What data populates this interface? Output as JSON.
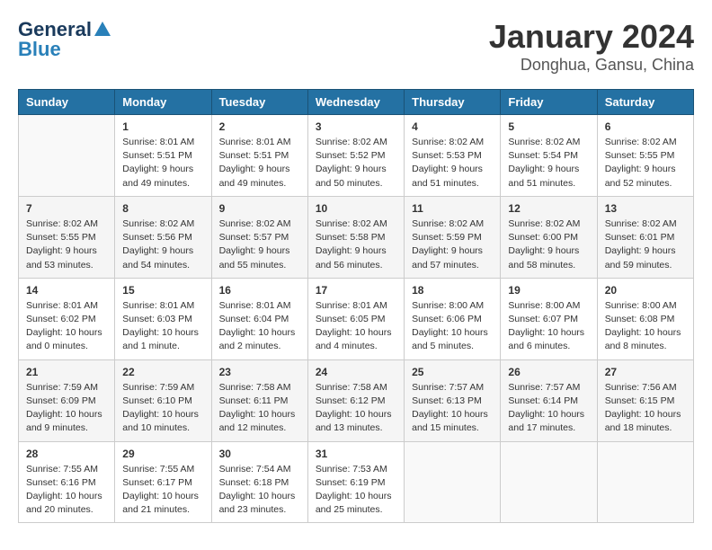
{
  "header": {
    "logo_general": "General",
    "logo_blue": "Blue",
    "month": "January 2024",
    "location": "Donghua, Gansu, China"
  },
  "days_of_week": [
    "Sunday",
    "Monday",
    "Tuesday",
    "Wednesday",
    "Thursday",
    "Friday",
    "Saturday"
  ],
  "weeks": [
    [
      {
        "day": "",
        "info": ""
      },
      {
        "day": "1",
        "info": "Sunrise: 8:01 AM\nSunset: 5:51 PM\nDaylight: 9 hours and 49 minutes."
      },
      {
        "day": "2",
        "info": "Sunrise: 8:01 AM\nSunset: 5:51 PM\nDaylight: 9 hours and 49 minutes."
      },
      {
        "day": "3",
        "info": "Sunrise: 8:02 AM\nSunset: 5:52 PM\nDaylight: 9 hours and 50 minutes."
      },
      {
        "day": "4",
        "info": "Sunrise: 8:02 AM\nSunset: 5:53 PM\nDaylight: 9 hours and 51 minutes."
      },
      {
        "day": "5",
        "info": "Sunrise: 8:02 AM\nSunset: 5:54 PM\nDaylight: 9 hours and 51 minutes."
      },
      {
        "day": "6",
        "info": "Sunrise: 8:02 AM\nSunset: 5:55 PM\nDaylight: 9 hours and 52 minutes."
      }
    ],
    [
      {
        "day": "7",
        "info": "Sunrise: 8:02 AM\nSunset: 5:55 PM\nDaylight: 9 hours and 53 minutes."
      },
      {
        "day": "8",
        "info": "Sunrise: 8:02 AM\nSunset: 5:56 PM\nDaylight: 9 hours and 54 minutes."
      },
      {
        "day": "9",
        "info": "Sunrise: 8:02 AM\nSunset: 5:57 PM\nDaylight: 9 hours and 55 minutes."
      },
      {
        "day": "10",
        "info": "Sunrise: 8:02 AM\nSunset: 5:58 PM\nDaylight: 9 hours and 56 minutes."
      },
      {
        "day": "11",
        "info": "Sunrise: 8:02 AM\nSunset: 5:59 PM\nDaylight: 9 hours and 57 minutes."
      },
      {
        "day": "12",
        "info": "Sunrise: 8:02 AM\nSunset: 6:00 PM\nDaylight: 9 hours and 58 minutes."
      },
      {
        "day": "13",
        "info": "Sunrise: 8:02 AM\nSunset: 6:01 PM\nDaylight: 9 hours and 59 minutes."
      }
    ],
    [
      {
        "day": "14",
        "info": "Sunrise: 8:01 AM\nSunset: 6:02 PM\nDaylight: 10 hours and 0 minutes."
      },
      {
        "day": "15",
        "info": "Sunrise: 8:01 AM\nSunset: 6:03 PM\nDaylight: 10 hours and 1 minute."
      },
      {
        "day": "16",
        "info": "Sunrise: 8:01 AM\nSunset: 6:04 PM\nDaylight: 10 hours and 2 minutes."
      },
      {
        "day": "17",
        "info": "Sunrise: 8:01 AM\nSunset: 6:05 PM\nDaylight: 10 hours and 4 minutes."
      },
      {
        "day": "18",
        "info": "Sunrise: 8:00 AM\nSunset: 6:06 PM\nDaylight: 10 hours and 5 minutes."
      },
      {
        "day": "19",
        "info": "Sunrise: 8:00 AM\nSunset: 6:07 PM\nDaylight: 10 hours and 6 minutes."
      },
      {
        "day": "20",
        "info": "Sunrise: 8:00 AM\nSunset: 6:08 PM\nDaylight: 10 hours and 8 minutes."
      }
    ],
    [
      {
        "day": "21",
        "info": "Sunrise: 7:59 AM\nSunset: 6:09 PM\nDaylight: 10 hours and 9 minutes."
      },
      {
        "day": "22",
        "info": "Sunrise: 7:59 AM\nSunset: 6:10 PM\nDaylight: 10 hours and 10 minutes."
      },
      {
        "day": "23",
        "info": "Sunrise: 7:58 AM\nSunset: 6:11 PM\nDaylight: 10 hours and 12 minutes."
      },
      {
        "day": "24",
        "info": "Sunrise: 7:58 AM\nSunset: 6:12 PM\nDaylight: 10 hours and 13 minutes."
      },
      {
        "day": "25",
        "info": "Sunrise: 7:57 AM\nSunset: 6:13 PM\nDaylight: 10 hours and 15 minutes."
      },
      {
        "day": "26",
        "info": "Sunrise: 7:57 AM\nSunset: 6:14 PM\nDaylight: 10 hours and 17 minutes."
      },
      {
        "day": "27",
        "info": "Sunrise: 7:56 AM\nSunset: 6:15 PM\nDaylight: 10 hours and 18 minutes."
      }
    ],
    [
      {
        "day": "28",
        "info": "Sunrise: 7:55 AM\nSunset: 6:16 PM\nDaylight: 10 hours and 20 minutes."
      },
      {
        "day": "29",
        "info": "Sunrise: 7:55 AM\nSunset: 6:17 PM\nDaylight: 10 hours and 21 minutes."
      },
      {
        "day": "30",
        "info": "Sunrise: 7:54 AM\nSunset: 6:18 PM\nDaylight: 10 hours and 23 minutes."
      },
      {
        "day": "31",
        "info": "Sunrise: 7:53 AM\nSunset: 6:19 PM\nDaylight: 10 hours and 25 minutes."
      },
      {
        "day": "",
        "info": ""
      },
      {
        "day": "",
        "info": ""
      },
      {
        "day": "",
        "info": ""
      }
    ]
  ]
}
